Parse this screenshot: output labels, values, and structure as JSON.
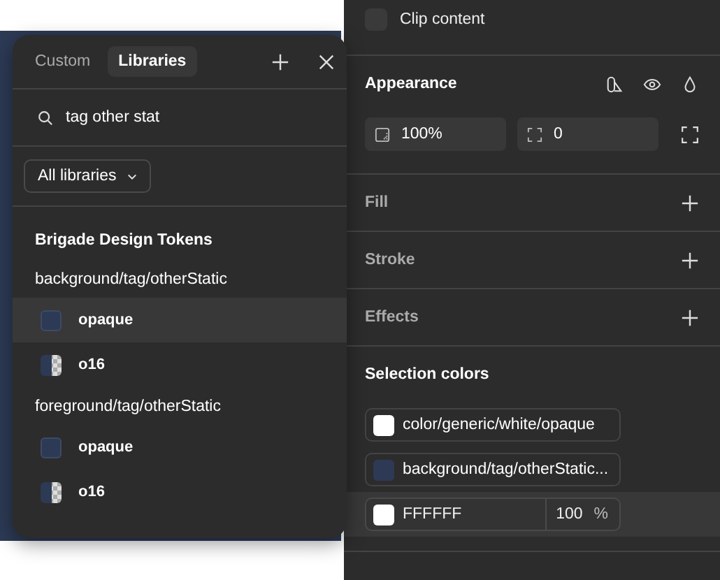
{
  "popup": {
    "tabs": [
      {
        "label": "Custom",
        "selected": false
      },
      {
        "label": "Libraries",
        "selected": true
      }
    ],
    "search": {
      "value": "tag other stat"
    },
    "filter": {
      "label": "All libraries"
    },
    "library": {
      "title": "Brigade Design Tokens",
      "groups": [
        {
          "name": "background/tag/otherStatic",
          "items": [
            {
              "name": "opaque",
              "kind": "solid",
              "selected": true
            },
            {
              "name": "o16",
              "kind": "translucent",
              "selected": false
            }
          ]
        },
        {
          "name": "foreground/tag/otherStatic",
          "items": [
            {
              "name": "opaque",
              "kind": "solid",
              "selected": false
            },
            {
              "name": "o16",
              "kind": "translucent",
              "selected": false
            }
          ]
        }
      ]
    }
  },
  "panel": {
    "clip_content": {
      "label": "Clip content",
      "checked": false
    },
    "appearance": {
      "title": "Appearance",
      "opacity": "100%",
      "radius": "0"
    },
    "sections": [
      {
        "title": "Fill"
      },
      {
        "title": "Stroke"
      },
      {
        "title": "Effects"
      }
    ],
    "selection_colors": {
      "title": "Selection colors",
      "items": [
        {
          "kind": "style",
          "name": "color/generic/white/opaque",
          "color": "#ffffff",
          "selected": false
        },
        {
          "kind": "style",
          "name": "background/tag/otherStatic...",
          "color": "#2e3a55",
          "selected": false
        },
        {
          "kind": "hex",
          "value": "FFFFFF",
          "opacity": "100",
          "unit": "%",
          "color": "#ffffff",
          "selected": true
        }
      ]
    }
  }
}
